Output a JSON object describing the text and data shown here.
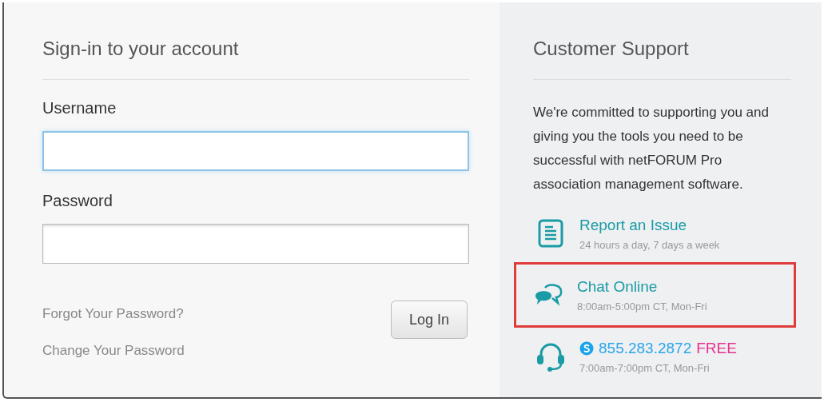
{
  "signin": {
    "title": "Sign-in to your account",
    "fields": [
      {
        "label": "Username",
        "focused": true
      },
      {
        "label": "Password",
        "focused": false
      }
    ],
    "links": [
      "Forgot Your Password?",
      "Change Your Password"
    ],
    "button": "Log In"
  },
  "support": {
    "title": "Customer Support",
    "intro": "We're committed to supporting you and giving you the tools you need to be successful with netFORUM Pro association management software.",
    "items": [
      {
        "kind": "document",
        "title": "Report an Issue",
        "hours": "24 hours a day, 7 days a week",
        "highlighted": false
      },
      {
        "kind": "chat",
        "title": "Chat Online",
        "hours": "8:00am-5:00pm CT, Mon-Fri",
        "highlighted": true
      },
      {
        "kind": "phone",
        "title": "855.283.2872",
        "badge": "FREE",
        "hours": "7:00am-7:00pm CT, Mon-Fri",
        "highlighted": false
      }
    ]
  }
}
